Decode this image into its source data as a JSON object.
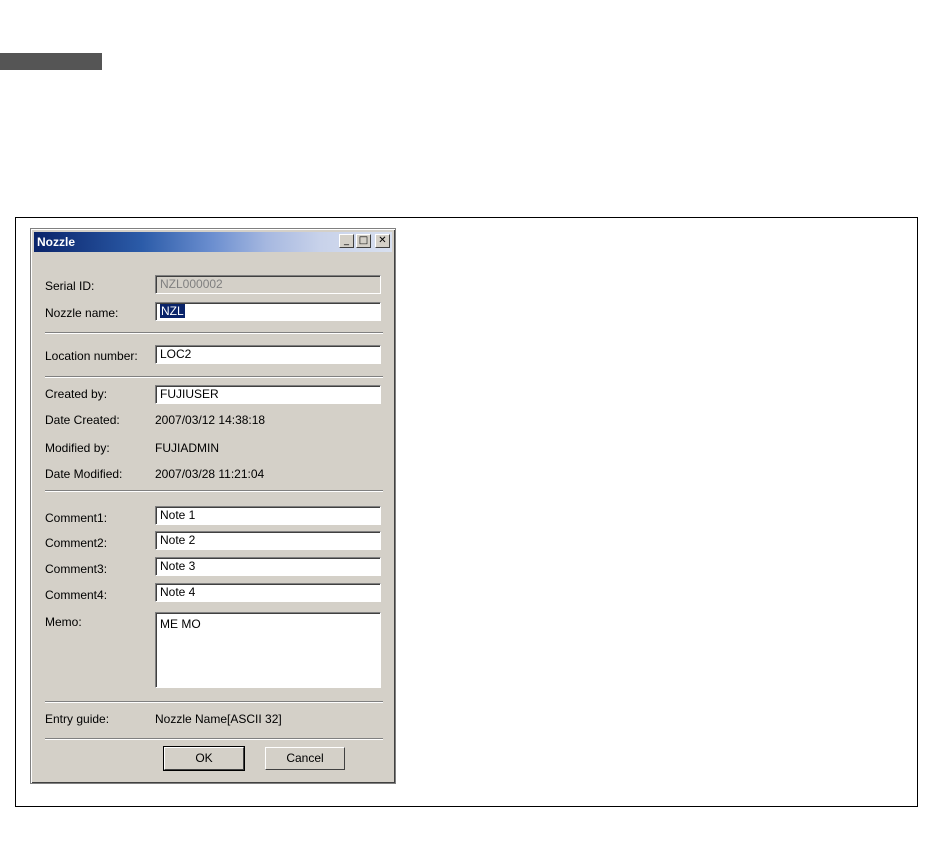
{
  "window": {
    "title": "Nozzle",
    "minimize_glyph": "_",
    "maximize_glyph": "□",
    "close_glyph": "✕"
  },
  "form": {
    "serial_id": {
      "label": "Serial ID:",
      "value": "NZL000002"
    },
    "nozzle_name": {
      "label": "Nozzle name:",
      "value": "NZL"
    },
    "location_number": {
      "label": "Location number:",
      "value": "LOC2"
    },
    "created_by": {
      "label": "Created by:",
      "value": "FUJIUSER"
    },
    "date_created": {
      "label": "Date Created:",
      "value": "2007/03/12 14:38:18"
    },
    "modified_by": {
      "label": "Modified by:",
      "value": "FUJIADMIN"
    },
    "date_modified": {
      "label": "Date Modified:",
      "value": "2007/03/28 11:21:04"
    },
    "comment1": {
      "label": "Comment1:",
      "value": "Note 1"
    },
    "comment2": {
      "label": "Comment2:",
      "value": "Note 2"
    },
    "comment3": {
      "label": "Comment3:",
      "value": "Note 3"
    },
    "comment4": {
      "label": "Comment4:",
      "value": "Note 4"
    },
    "memo": {
      "label": "Memo:",
      "value": "ME MO"
    },
    "entry_guide": {
      "label": "Entry guide:",
      "value": "Nozzle Name[ASCII 32]"
    }
  },
  "buttons": {
    "ok": "OK",
    "cancel": "Cancel"
  }
}
